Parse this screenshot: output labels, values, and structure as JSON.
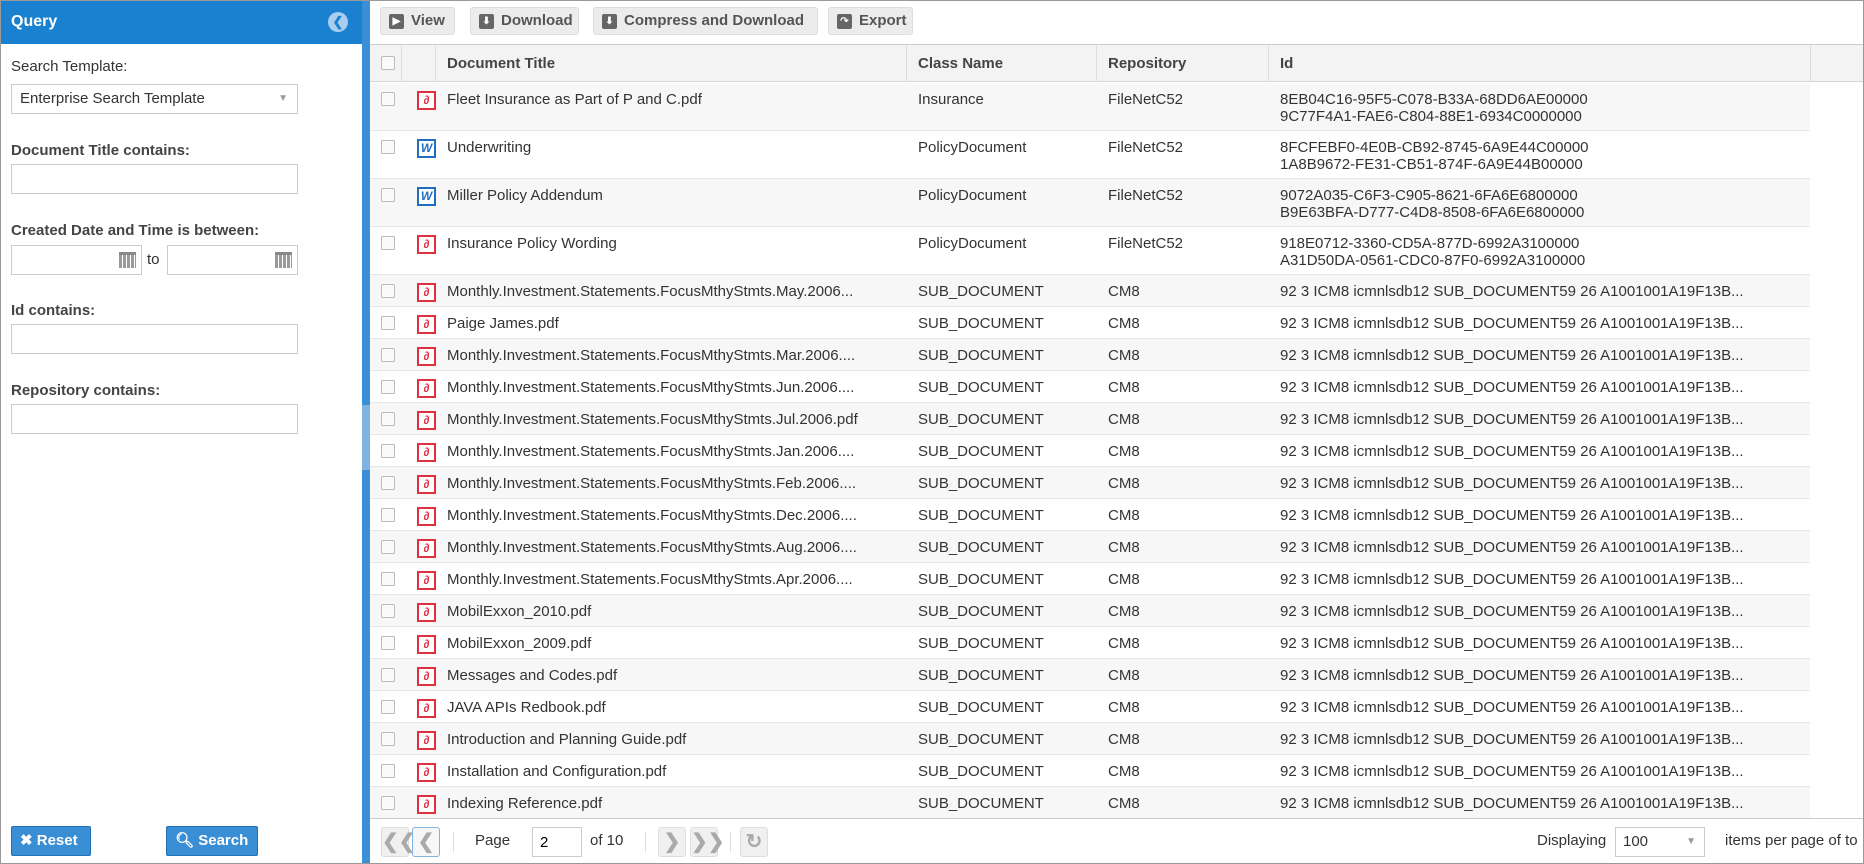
{
  "sidebar": {
    "title": "Query",
    "search_template_label": "Search Template:",
    "search_template_value": "Enterprise Search Template",
    "doc_title_label": "Document Title contains:",
    "doc_title_value": "",
    "created_label": "Created Date and Time is between:",
    "created_from": "",
    "created_to": "",
    "to_label": "to",
    "id_label": "Id contains:",
    "id_value": "",
    "repo_label": "Repository contains:",
    "repo_value": "",
    "reset_label": "Reset",
    "search_label": "Search"
  },
  "toolbar": {
    "view": "View",
    "download": "Download",
    "compress": "Compress and Download",
    "export": "Export"
  },
  "columns": [
    "Document Title",
    "Class Name",
    "Repository",
    "Id"
  ],
  "rows": [
    {
      "type": "pdf",
      "title": "Fleet Insurance as Part of P and C.pdf",
      "class": "Insurance",
      "repo": "FileNetC52",
      "id": [
        "8EB04C16-95F5-C078-B33A-68DD6AE00000",
        "9C77F4A1-FAE6-C804-88E1-6934C0000000"
      ]
    },
    {
      "type": "word",
      "title": "Underwriting",
      "class": "PolicyDocument",
      "repo": "FileNetC52",
      "id": [
        "8FCFEBF0-4E0B-CB92-8745-6A9E44C00000",
        "1A8B9672-FE31-CB51-874F-6A9E44B00000"
      ]
    },
    {
      "type": "word",
      "title": "Miller Policy Addendum",
      "class": "PolicyDocument",
      "repo": "FileNetC52",
      "id": [
        "9072A035-C6F3-C905-8621-6FA6E6800000",
        "B9E63BFA-D777-C4D8-8508-6FA6E6800000"
      ]
    },
    {
      "type": "pdf",
      "title": "Insurance Policy Wording",
      "class": "PolicyDocument",
      "repo": "FileNetC52",
      "id": [
        "918E0712-3360-CD5A-877D-6992A3100000",
        "A31D50DA-0561-CDC0-87F0-6992A3100000"
      ]
    },
    {
      "type": "pdf",
      "title": "Monthly.Investment.Statements.FocusMthyStmts.May.2006...",
      "class": "SUB_DOCUMENT",
      "repo": "CM8",
      "id": [
        "92 3 ICM8 icmnlsdb12 SUB_DOCUMENT59 26 A1001001A19F13B..."
      ]
    },
    {
      "type": "pdf",
      "title": "Paige James.pdf",
      "class": "SUB_DOCUMENT",
      "repo": "CM8",
      "id": [
        "92 3 ICM8 icmnlsdb12 SUB_DOCUMENT59 26 A1001001A19F13B..."
      ]
    },
    {
      "type": "pdf",
      "title": "Monthly.Investment.Statements.FocusMthyStmts.Mar.2006....",
      "class": "SUB_DOCUMENT",
      "repo": "CM8",
      "id": [
        "92 3 ICM8 icmnlsdb12 SUB_DOCUMENT59 26 A1001001A19F13B..."
      ]
    },
    {
      "type": "pdf",
      "title": "Monthly.Investment.Statements.FocusMthyStmts.Jun.2006....",
      "class": "SUB_DOCUMENT",
      "repo": "CM8",
      "id": [
        "92 3 ICM8 icmnlsdb12 SUB_DOCUMENT59 26 A1001001A19F13B..."
      ]
    },
    {
      "type": "pdf",
      "title": "Monthly.Investment.Statements.FocusMthyStmts.Jul.2006.pdf",
      "class": "SUB_DOCUMENT",
      "repo": "CM8",
      "id": [
        "92 3 ICM8 icmnlsdb12 SUB_DOCUMENT59 26 A1001001A19F13B..."
      ]
    },
    {
      "type": "pdf",
      "title": "Monthly.Investment.Statements.FocusMthyStmts.Jan.2006....",
      "class": "SUB_DOCUMENT",
      "repo": "CM8",
      "id": [
        "92 3 ICM8 icmnlsdb12 SUB_DOCUMENT59 26 A1001001A19F13B..."
      ]
    },
    {
      "type": "pdf",
      "title": "Monthly.Investment.Statements.FocusMthyStmts.Feb.2006....",
      "class": "SUB_DOCUMENT",
      "repo": "CM8",
      "id": [
        "92 3 ICM8 icmnlsdb12 SUB_DOCUMENT59 26 A1001001A19F13B..."
      ]
    },
    {
      "type": "pdf",
      "title": "Monthly.Investment.Statements.FocusMthyStmts.Dec.2006....",
      "class": "SUB_DOCUMENT",
      "repo": "CM8",
      "id": [
        "92 3 ICM8 icmnlsdb12 SUB_DOCUMENT59 26 A1001001A19F13B..."
      ]
    },
    {
      "type": "pdf",
      "title": "Monthly.Investment.Statements.FocusMthyStmts.Aug.2006....",
      "class": "SUB_DOCUMENT",
      "repo": "CM8",
      "id": [
        "92 3 ICM8 icmnlsdb12 SUB_DOCUMENT59 26 A1001001A19F13B..."
      ]
    },
    {
      "type": "pdf",
      "title": "Monthly.Investment.Statements.FocusMthyStmts.Apr.2006....",
      "class": "SUB_DOCUMENT",
      "repo": "CM8",
      "id": [
        "92 3 ICM8 icmnlsdb12 SUB_DOCUMENT59 26 A1001001A19F13B..."
      ]
    },
    {
      "type": "pdf",
      "title": "MobilExxon_2010.pdf",
      "class": "SUB_DOCUMENT",
      "repo": "CM8",
      "id": [
        "92 3 ICM8 icmnlsdb12 SUB_DOCUMENT59 26 A1001001A19F13B..."
      ]
    },
    {
      "type": "pdf",
      "title": "MobilExxon_2009.pdf",
      "class": "SUB_DOCUMENT",
      "repo": "CM8",
      "id": [
        "92 3 ICM8 icmnlsdb12 SUB_DOCUMENT59 26 A1001001A19F13B..."
      ]
    },
    {
      "type": "pdf",
      "title": "Messages and Codes.pdf",
      "class": "SUB_DOCUMENT",
      "repo": "CM8",
      "id": [
        "92 3 ICM8 icmnlsdb12 SUB_DOCUMENT59 26 A1001001A19F13B..."
      ]
    },
    {
      "type": "pdf",
      "title": "JAVA APIs Redbook.pdf",
      "class": "SUB_DOCUMENT",
      "repo": "CM8",
      "id": [
        "92 3 ICM8 icmnlsdb12 SUB_DOCUMENT59 26 A1001001A19F13B..."
      ]
    },
    {
      "type": "pdf",
      "title": "Introduction and Planning Guide.pdf",
      "class": "SUB_DOCUMENT",
      "repo": "CM8",
      "id": [
        "92 3 ICM8 icmnlsdb12 SUB_DOCUMENT59 26 A1001001A19F13B..."
      ]
    },
    {
      "type": "pdf",
      "title": "Installation and Configuration.pdf",
      "class": "SUB_DOCUMENT",
      "repo": "CM8",
      "id": [
        "92 3 ICM8 icmnlsdb12 SUB_DOCUMENT59 26 A1001001A19F13B..."
      ]
    },
    {
      "type": "pdf",
      "title": "Indexing Reference.pdf",
      "class": "SUB_DOCUMENT",
      "repo": "CM8",
      "id": [
        "92 3 ICM8 icmnlsdb12 SUB_DOCUMENT59 26 A1001001A19F13B..."
      ]
    }
  ],
  "pager": {
    "page_label": "Page",
    "page": "2",
    "of_label": "of 10",
    "displaying_label": "Displaying",
    "per_page": "100",
    "items_label": "items per page of to"
  },
  "colors": {
    "header": "#1a80d0",
    "pdf": "#e03040",
    "word": "#1f6fc0"
  }
}
